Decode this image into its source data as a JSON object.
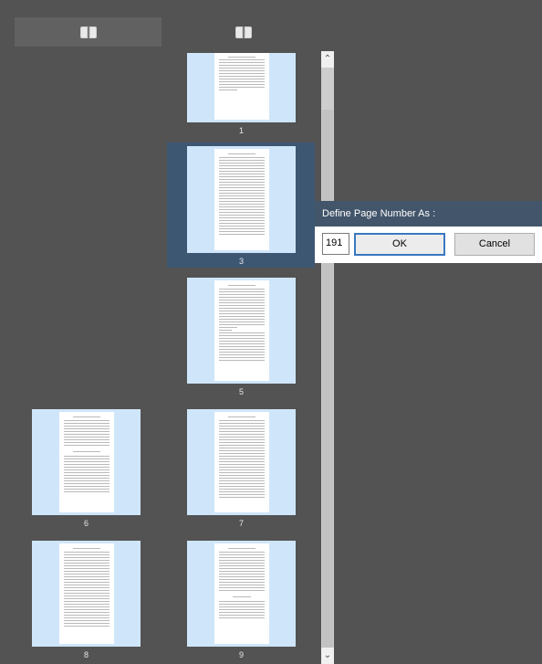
{
  "toolbar": {
    "buttons": [
      {
        "icon": "book-icon",
        "active": true
      },
      {
        "icon": "book-icon",
        "active": false
      }
    ]
  },
  "thumbnails": [
    {
      "label": "1",
      "selected": false
    },
    {
      "label": "3",
      "selected": true
    },
    {
      "label": "5",
      "selected": false
    },
    {
      "label": "6",
      "selected": false
    },
    {
      "label": "7",
      "selected": false
    },
    {
      "label": "8",
      "selected": false
    },
    {
      "label": "9",
      "selected": false
    }
  ],
  "scrollbar": {
    "up_icon": "chevron-up-icon",
    "down_icon": "chevron-down-icon"
  },
  "dialog": {
    "title": "Define Page Number As :",
    "input_value": "191",
    "ok_label": "OK",
    "cancel_label": "Cancel"
  }
}
